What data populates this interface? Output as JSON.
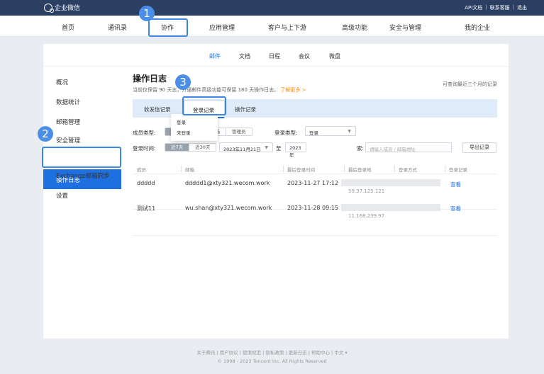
{
  "app": {
    "brand": "企业微信"
  },
  "topbar": {
    "links": [
      "API文档",
      "联系客服",
      "退出"
    ]
  },
  "nav": [
    "首页",
    "通讯录",
    "协作",
    "应用管理",
    "客户与上下游",
    "高级功能",
    "安全与管理",
    "我的企业"
  ],
  "subnav": [
    "邮件",
    "文档",
    "日程",
    "会议",
    "微盘"
  ],
  "sidebar": [
    "概况",
    "数据统计",
    "邮箱管理",
    "安全管理",
    "操作日志",
    "Exchange邮箱同步",
    "设置"
  ],
  "page": {
    "title": "操作日志",
    "desc_prefix": "当前仅保留 90 天",
    "desc_middle": "志，开通邮件高级功能可保留 180 天操作日志。",
    "desc_more": "了解更多 >",
    "note": "可查询最近三个月的记录"
  },
  "tabs": [
    "收发信记录",
    "登录记录",
    "操作记录"
  ],
  "filters": {
    "member_type_label": "成员类型:",
    "member_types": [
      "普通成员",
      "公共邮箱",
      "管理员"
    ],
    "login_type_label": "登录类型:",
    "login_type_value": "登录",
    "login_time_label": "登录时间:",
    "time_ranges": [
      "近7天",
      "近30天"
    ],
    "date_from": "2023年11月21日",
    "date_to_label": "至",
    "date_to_partial": "2023年",
    "search_label_tail": "索:",
    "search_placeholder": "请输入成员 / 邮箱地址",
    "export": "导出记录"
  },
  "dropdown": [
    "登录",
    "未登录"
  ],
  "table": {
    "headers": [
      "成员",
      "邮箱",
      "最后登录时间",
      "最后登录地",
      "登录方式",
      "登录记录"
    ],
    "rows": [
      {
        "member": "ddddd",
        "email": "ddddd1@xty321.wecom.work",
        "time": "2023-11-27 17:12",
        "ip": "59.37.125.121",
        "action": "查看"
      },
      {
        "member": "测试11",
        "email": "wu.shan@xty321.wecom.work",
        "time": "2023-11-28 09:15",
        "ip": "11.168.239.97",
        "action": "查看"
      }
    ]
  },
  "footer": {
    "links": [
      "关于腾讯",
      "用户协议",
      "使用规范",
      "隐私政策",
      "更新日志",
      "帮助中心",
      "中文 ▾"
    ],
    "copyright": "© 1998 - 2023 Tencent Inc. All Rights Reserved"
  },
  "badges": [
    "1",
    "2",
    "3"
  ]
}
